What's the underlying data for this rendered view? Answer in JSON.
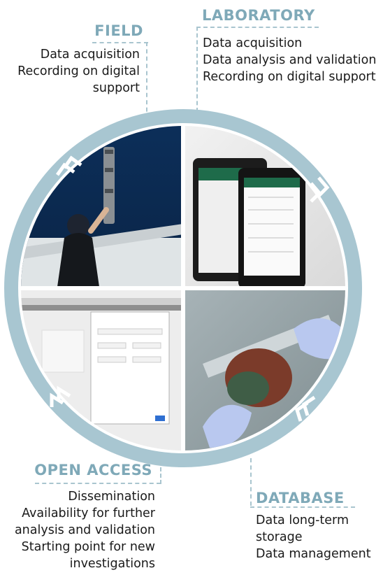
{
  "field": {
    "title": "FIELD",
    "lines": [
      "Data acquisition",
      "Recording on digital",
      "support"
    ]
  },
  "laboratory": {
    "title": "LABORATORY",
    "lines": [
      "Data acquisition",
      "Data analysis and validation",
      "Recording on digital support"
    ]
  },
  "open_access": {
    "title": "OPEN ACCESS",
    "lines": [
      "Dissemination",
      "Availability for further",
      "analysis and validation",
      "Starting point for new",
      "investigations"
    ]
  },
  "database": {
    "title": "DATABASE",
    "lines": [
      "Data long-term",
      "storage",
      "Data management"
    ]
  },
  "colors": {
    "accent": "#7fa9b8",
    "ring": "#a8c6d1",
    "text": "#1a1a1a"
  }
}
